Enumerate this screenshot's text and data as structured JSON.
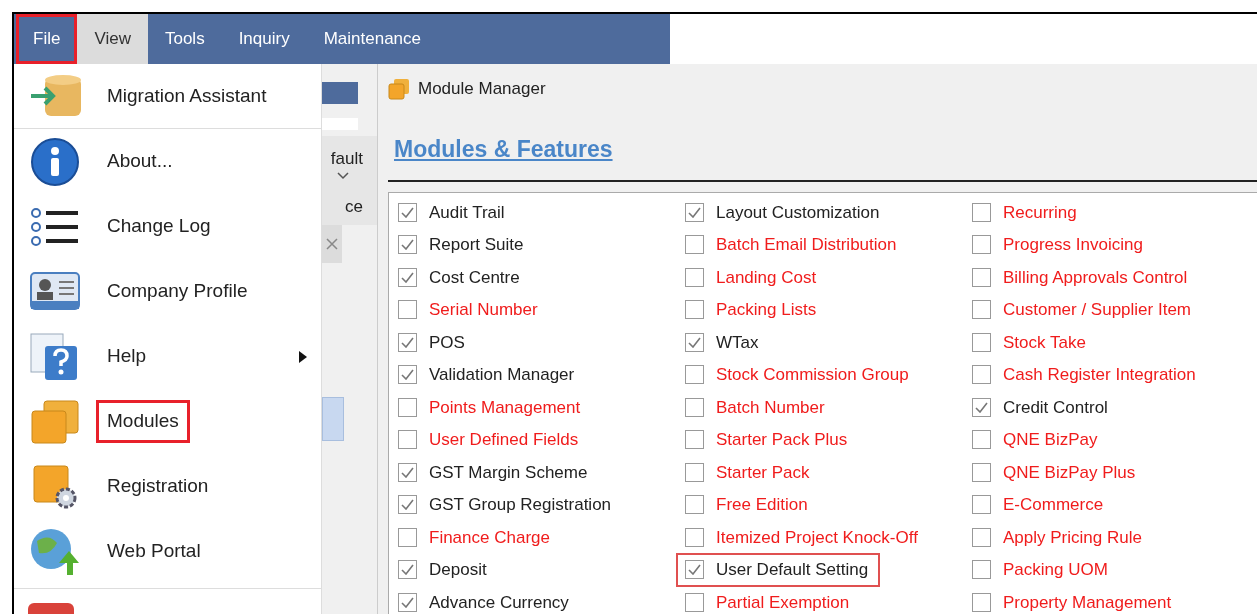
{
  "menu_bar": {
    "tabs": [
      {
        "label": "File",
        "selected": false,
        "highlighted": true
      },
      {
        "label": "View",
        "selected": true,
        "highlighted": false
      },
      {
        "label": "Tools",
        "selected": false,
        "highlighted": false
      },
      {
        "label": "Inquiry",
        "selected": false,
        "highlighted": false
      },
      {
        "label": "Maintenance",
        "selected": false,
        "highlighted": false
      }
    ]
  },
  "file_menu": {
    "items": [
      {
        "kind": "migration",
        "label": "Migration Assistant",
        "submenu": false,
        "highlighted": false
      },
      {
        "kind": "about",
        "label": "About...",
        "submenu": false,
        "highlighted": false
      },
      {
        "kind": "changelog",
        "label": "Change Log",
        "submenu": false,
        "highlighted": false
      },
      {
        "kind": "profile",
        "label": "Company Profile",
        "submenu": false,
        "highlighted": false
      },
      {
        "kind": "help",
        "label": "Help",
        "submenu": true,
        "highlighted": false
      },
      {
        "kind": "modules",
        "label": "Modules",
        "submenu": false,
        "highlighted": true
      },
      {
        "kind": "registration",
        "label": "Registration",
        "submenu": false,
        "highlighted": false
      },
      {
        "kind": "webportal",
        "label": "Web Portal",
        "submenu": false,
        "highlighted": false
      }
    ]
  },
  "background_panel": {
    "texts": [
      "fault",
      "ce"
    ]
  },
  "module_manager": {
    "title": "Module Manager",
    "heading": "Modules & Features",
    "columns": [
      [
        {
          "label": "Audit Trail",
          "checked": true,
          "available": true,
          "highlighted": false
        },
        {
          "label": "Report Suite",
          "checked": true,
          "available": true,
          "highlighted": false
        },
        {
          "label": "Cost Centre",
          "checked": true,
          "available": true,
          "highlighted": false
        },
        {
          "label": "Serial Number",
          "checked": false,
          "available": false,
          "highlighted": false
        },
        {
          "label": "POS",
          "checked": true,
          "available": true,
          "highlighted": false
        },
        {
          "label": "Validation Manager",
          "checked": true,
          "available": true,
          "highlighted": false
        },
        {
          "label": "Points Management",
          "checked": false,
          "available": false,
          "highlighted": false
        },
        {
          "label": "User Defined Fields",
          "checked": false,
          "available": false,
          "highlighted": false
        },
        {
          "label": "GST Margin Scheme",
          "checked": true,
          "available": true,
          "highlighted": false
        },
        {
          "label": "GST Group Registration",
          "checked": true,
          "available": true,
          "highlighted": false
        },
        {
          "label": "Finance Charge",
          "checked": false,
          "available": false,
          "highlighted": false
        },
        {
          "label": "Deposit",
          "checked": true,
          "available": true,
          "highlighted": false
        },
        {
          "label": "Advance Currency",
          "checked": true,
          "available": true,
          "highlighted": false
        }
      ],
      [
        {
          "label": "Layout Customization",
          "checked": true,
          "available": true,
          "highlighted": false
        },
        {
          "label": "Batch Email Distribution",
          "checked": false,
          "available": false,
          "highlighted": false
        },
        {
          "label": "Landing Cost",
          "checked": false,
          "available": false,
          "highlighted": false
        },
        {
          "label": "Packing Lists",
          "checked": false,
          "available": false,
          "highlighted": false
        },
        {
          "label": "WTax",
          "checked": true,
          "available": true,
          "highlighted": false
        },
        {
          "label": "Stock Commission Group",
          "checked": false,
          "available": false,
          "highlighted": false
        },
        {
          "label": "Batch Number",
          "checked": false,
          "available": false,
          "highlighted": false
        },
        {
          "label": "Starter Pack Plus",
          "checked": false,
          "available": false,
          "highlighted": false
        },
        {
          "label": "Starter Pack",
          "checked": false,
          "available": false,
          "highlighted": false
        },
        {
          "label": "Free Edition",
          "checked": false,
          "available": false,
          "highlighted": false
        },
        {
          "label": "Itemized Project Knock-Off",
          "checked": false,
          "available": false,
          "highlighted": false
        },
        {
          "label": "User Default Setting",
          "checked": true,
          "available": true,
          "highlighted": true
        },
        {
          "label": "Partial Exemption",
          "checked": false,
          "available": false,
          "highlighted": false
        }
      ],
      [
        {
          "label": "Recurring",
          "checked": false,
          "available": false,
          "highlighted": false
        },
        {
          "label": "Progress Invoicing",
          "checked": false,
          "available": false,
          "highlighted": false
        },
        {
          "label": "Billing Approvals Control",
          "checked": false,
          "available": false,
          "highlighted": false
        },
        {
          "label": "Customer / Supplier Item",
          "checked": false,
          "available": false,
          "highlighted": false
        },
        {
          "label": "Stock Take",
          "checked": false,
          "available": false,
          "highlighted": false
        },
        {
          "label": "Cash Register Integration",
          "checked": false,
          "available": false,
          "highlighted": false
        },
        {
          "label": "Credit Control",
          "checked": true,
          "available": true,
          "highlighted": false
        },
        {
          "label": "QNE BizPay",
          "checked": false,
          "available": false,
          "highlighted": false
        },
        {
          "label": "QNE BizPay Plus",
          "checked": false,
          "available": false,
          "highlighted": false
        },
        {
          "label": "E-Commerce",
          "checked": false,
          "available": false,
          "highlighted": false
        },
        {
          "label": "Apply Pricing Rule",
          "checked": false,
          "available": false,
          "highlighted": false
        },
        {
          "label": "Packing UOM",
          "checked": false,
          "available": false,
          "highlighted": false
        },
        {
          "label": "Property Management",
          "checked": false,
          "available": false,
          "highlighted": false
        }
      ]
    ]
  }
}
